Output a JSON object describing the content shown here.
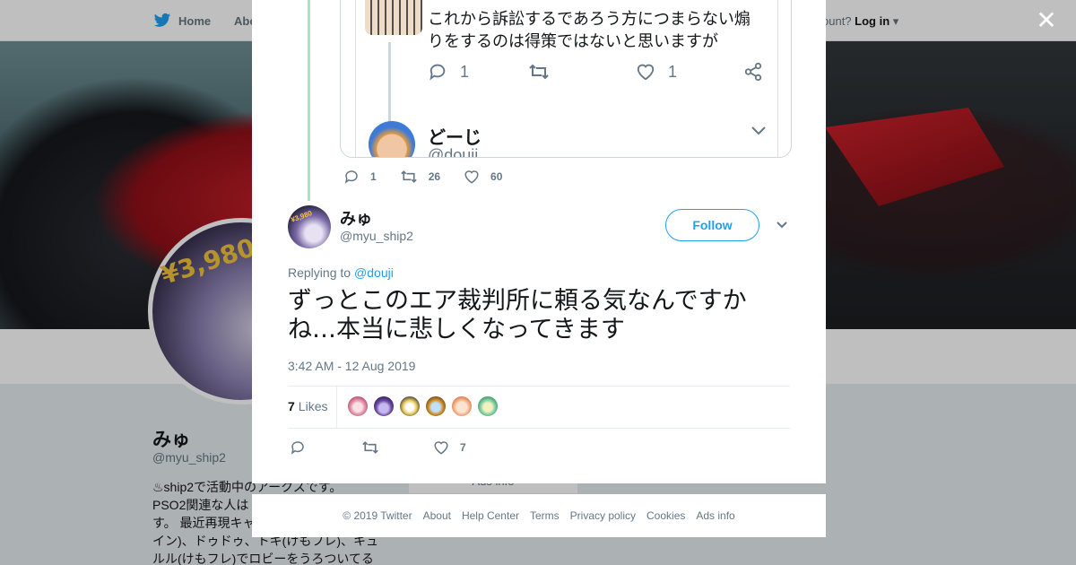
{
  "nav": {
    "home": "Home",
    "about": "Abo",
    "account_text": "ccount?",
    "login": "Log in"
  },
  "profile": {
    "name": "みゅ",
    "handle": "@myu_ship2",
    "price_label": "¥3,980",
    "bio_lines": [
      "♨ship2で活動中のアークスです。",
      "PSO2関連な人は",
      "す。 最近再現キャ",
      "イン)、ドゥドゥ、トキ(けもフレ)、キュ",
      "ルル(けもフレ)でロビーをうろついてる"
    ]
  },
  "ads_info_bg": "Ads info",
  "close_symbol": "✕",
  "quoted": {
    "text_line1": "これから訴訟するであろう方につまらない煽",
    "text_line2": "りをするのは得策ではないと思いますが",
    "reply_count": "1",
    "like_count": "1",
    "reply_user_name": "どーじ",
    "reply_user_handle": "@douji"
  },
  "quote_actions": {
    "replies": "1",
    "retweets": "26",
    "likes": "60"
  },
  "tweet": {
    "author_name": "みゅ",
    "author_handle": "@myu_ship2",
    "follow_label": "Follow",
    "replying_label": "Replying to",
    "replying_mention": "@douji",
    "text_line1": "ずっとこのエア裁判所に頼る気なんですか",
    "text_line2": "ね…本当に悲しくなってきます",
    "timestamp": "3:42 AM - 12 Aug 2019",
    "likes_count": "7",
    "likes_label": "Likes",
    "action_likes": "7"
  },
  "likers": [
    {
      "color": "#e8a0b4"
    },
    {
      "color": "#6a4aa0"
    },
    {
      "color": "#f0d060"
    },
    {
      "color": "#d0902a"
    },
    {
      "color": "#f4b890"
    },
    {
      "color": "#7fd0a0"
    }
  ],
  "footer": [
    "© 2019 Twitter",
    "About",
    "Help Center",
    "Terms",
    "Privacy policy",
    "Cookies",
    "Ads info"
  ],
  "colors": {
    "twitter_blue": "#1da1f2",
    "thread_line": "#a3e8c4",
    "muted": "#657786"
  }
}
